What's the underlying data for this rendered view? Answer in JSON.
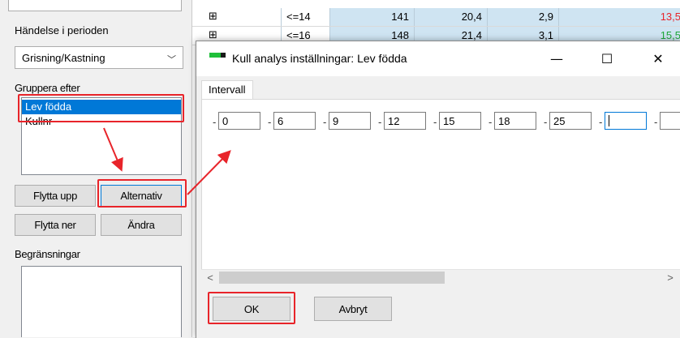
{
  "left_panel": {
    "event_label": "Händelse i perioden",
    "event_select_value": "Grisning/Kastning",
    "group_label": "Gruppera efter",
    "group_items": [
      {
        "label": "Lev födda",
        "selected": true
      },
      {
        "label": "Kullnr",
        "selected": false
      }
    ],
    "move_up_label": "Flytta upp",
    "options_label": "Alternativ",
    "move_down_label": "Flytta ner",
    "change_label": "Ändra",
    "restrictions_label": "Begränsningar"
  },
  "grid": {
    "rows": [
      {
        "label": "<=14",
        "c1": "141",
        "c2": "20,4",
        "c3": "2,9",
        "c4": "13,5",
        "c4_color": "#e8242a"
      },
      {
        "label": "<=16",
        "c1": "148",
        "c2": "21,4",
        "c3": "3,1",
        "c4": "15,5",
        "c4_color": "#1fa83a"
      }
    ]
  },
  "dialog": {
    "title": "Kull analys inställningar: Lev födda",
    "minimize_glyph": "—",
    "maximize_glyph": "☐",
    "close_glyph": "✕",
    "tab_label": "Intervall",
    "dash": "-",
    "intervals": [
      "0",
      "6",
      "9",
      "12",
      "15",
      "18",
      "25",
      "",
      ""
    ],
    "scroll_left_glyph": "<",
    "scroll_right_glyph": ">",
    "ok_label": "OK",
    "cancel_label": "Avbryt"
  },
  "colors": {
    "highlight_red": "#e8242a",
    "selection_blue": "#0078d7",
    "cell_blue": "#cfe4f2",
    "icon_green": "#1fbf3a"
  },
  "icons": {
    "tree_expand": "⊞",
    "chevron_down": "﹀"
  }
}
